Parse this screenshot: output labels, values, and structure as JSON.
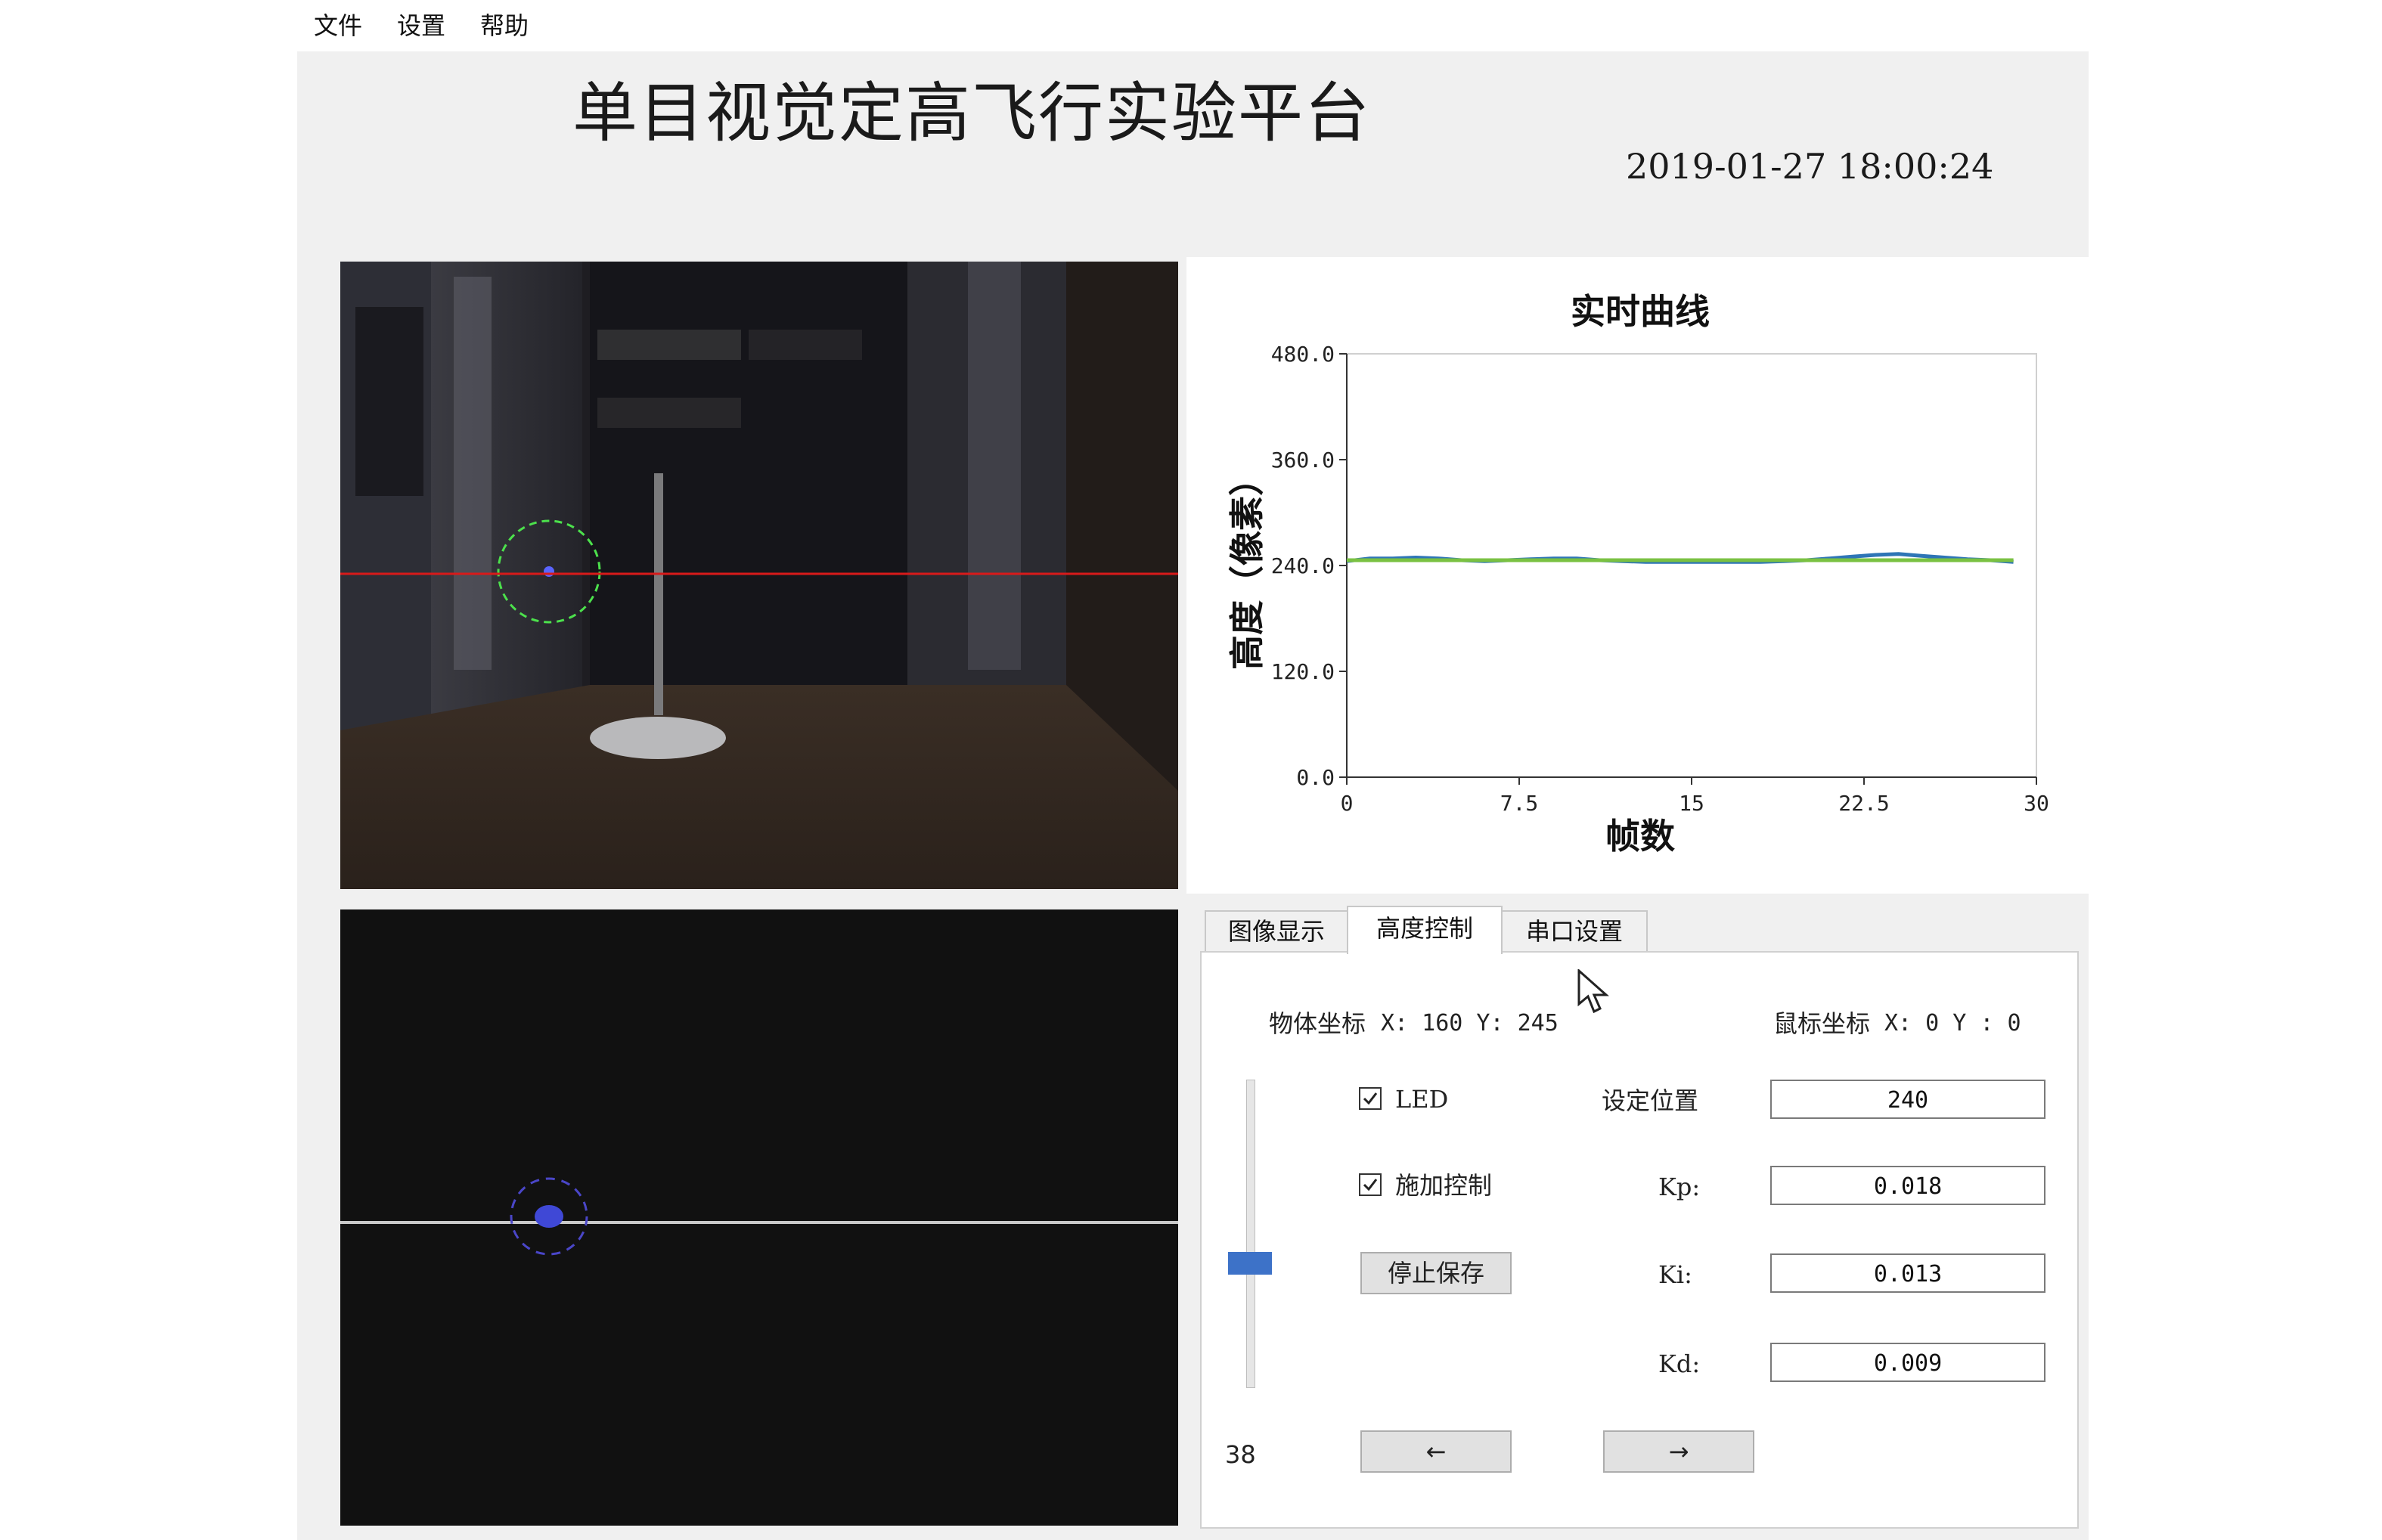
{
  "menu": {
    "file": "文件",
    "settings": "设置",
    "help": "帮助"
  },
  "header": {
    "title": "单目视觉定高飞行实验平台",
    "datetime": "2019-01-27 18:00:24"
  },
  "chart_data": {
    "type": "line",
    "title": "实时曲线",
    "xlabel": "帧数",
    "ylabel": "高度（像素）",
    "xlim": [
      0,
      30
    ],
    "ylim": [
      0,
      480
    ],
    "x_ticks": [
      "0",
      "7.5",
      "15",
      "22.5",
      "30"
    ],
    "y_ticks": [
      "0.0",
      "120.0",
      "240.0",
      "360.0",
      "480.0"
    ],
    "grid": false,
    "colors": {
      "measured": "#2e75b6",
      "setpoint": "#7ac142"
    },
    "series": [
      {
        "x": [
          0,
          1,
          2,
          3,
          4,
          5,
          6,
          7,
          8,
          9,
          10,
          11,
          12,
          13,
          14,
          15,
          16,
          17,
          18,
          19,
          20,
          21,
          22,
          23,
          24,
          25,
          26,
          27,
          28,
          29
        ],
        "values": [
          245,
          248,
          248,
          249,
          248,
          246,
          245,
          246,
          247,
          248,
          248,
          246,
          245,
          244,
          244,
          244,
          244,
          244,
          244,
          245,
          246,
          248,
          250,
          252,
          253,
          251,
          249,
          247,
          246,
          244
        ]
      },
      {
        "x": [
          0,
          29
        ],
        "values": [
          246,
          246
        ]
      }
    ]
  },
  "tabs": [
    {
      "label": "图像显示"
    },
    {
      "label": "高度控制"
    },
    {
      "label": "串口设置"
    }
  ],
  "control": {
    "object_coord_label": "物体坐标",
    "object_coord_value": "X: 160 Y: 245",
    "mouse_coord_label": "鼠标坐标",
    "mouse_coord_value": "X: 0  Y : 0",
    "led_label": "LED",
    "led_checked": true,
    "apply_control_label": "施加控制",
    "apply_control_checked": true,
    "stop_save_label": "停止保存",
    "setpoint_label": "设定位置",
    "setpoint_value": "240",
    "kp_label": "Kp:",
    "kp_value": "0.018",
    "ki_label": "Ki:",
    "ki_value": "0.013",
    "kd_label": "Kd:",
    "kd_value": "0.009",
    "slider_value": "38",
    "left_arrow": "←",
    "right_arrow": "→"
  }
}
